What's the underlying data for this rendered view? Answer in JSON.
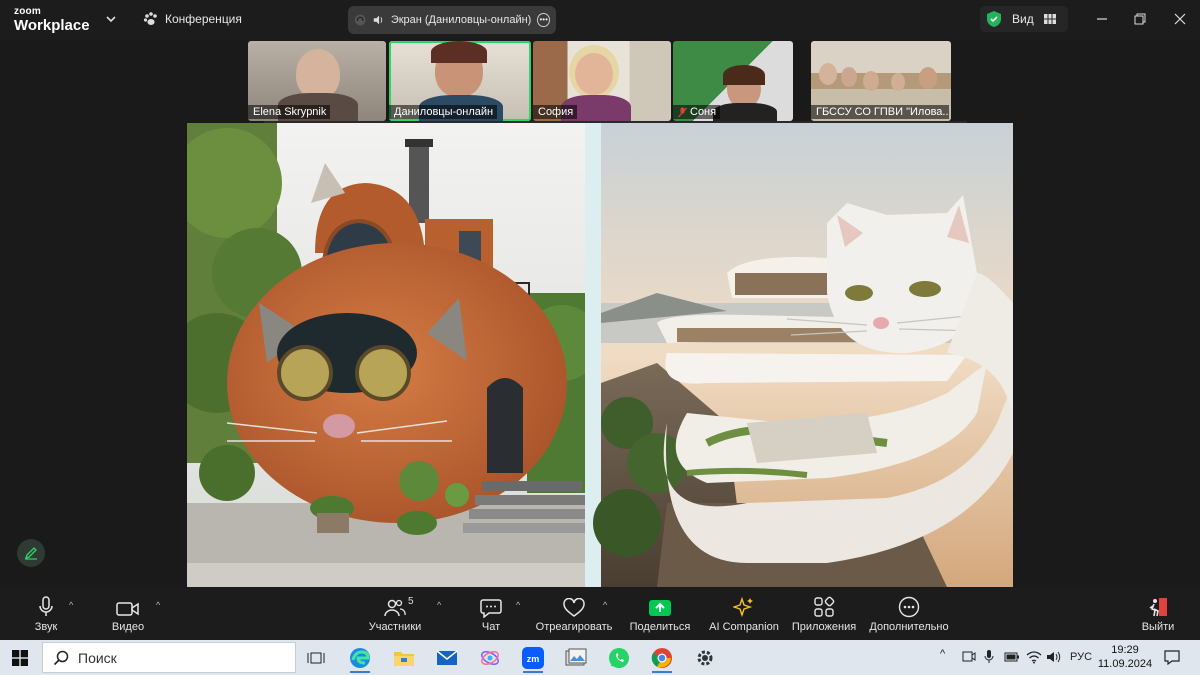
{
  "app": {
    "logo_small": "zoom",
    "logo_big": "Workplace",
    "meeting_label": "Конференция",
    "screen_share_label": "Экран (Даниловцы-онлайн)",
    "view_label": "Вид"
  },
  "participants": [
    {
      "name": "Elena Skrypnik",
      "muted": false,
      "active": false
    },
    {
      "name": "Даниловцы-онлайн",
      "muted": false,
      "active": true
    },
    {
      "name": "София",
      "muted": false,
      "active": false
    },
    {
      "name": "Соня",
      "muted": true,
      "active": false
    },
    {
      "name": "ГБССУ СО ГПВИ \"Илова...",
      "muted": false,
      "active": false
    }
  ],
  "toolbar": {
    "audio": "Звук",
    "video": "Видео",
    "participants": "Участники",
    "participants_count": "5",
    "chat": "Чат",
    "react": "Отреагировать",
    "share": "Поделиться",
    "ai": "AI Companion",
    "apps": "Приложения",
    "more": "Дополнительно",
    "leave": "Выйти"
  },
  "taskbar": {
    "search_placeholder": "Поиск",
    "lang": "РУС",
    "time": "19:29",
    "date": "11.09.2024"
  },
  "colors": {
    "accent_green": "#2fd36b",
    "share_green": "#00c853",
    "leave_red": "#e0433b",
    "security_green": "#23b35a"
  }
}
